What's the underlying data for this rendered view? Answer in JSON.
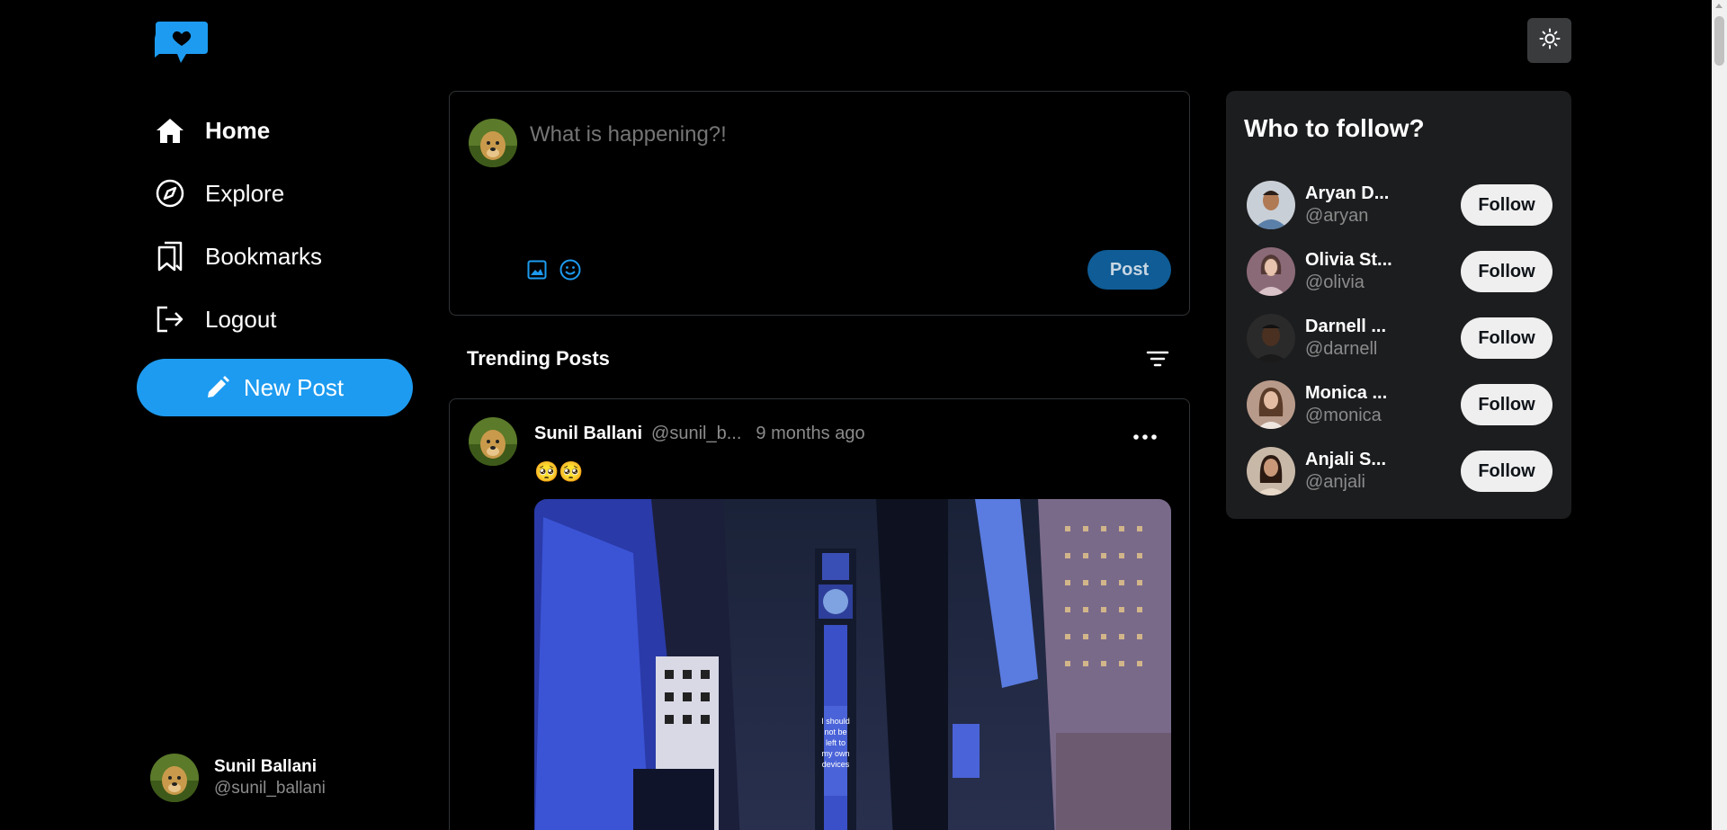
{
  "logo": {
    "icon": "chat-heart-logo-icon",
    "color": "#1d9bf0"
  },
  "nav": {
    "items": [
      {
        "label": "Home",
        "icon": "home-icon",
        "active": true
      },
      {
        "label": "Explore",
        "icon": "compass-icon"
      },
      {
        "label": "Bookmarks",
        "icon": "bookmarks-icon"
      },
      {
        "label": "Logout",
        "icon": "logout-icon"
      }
    ],
    "new_post_label": "New Post"
  },
  "current_user": {
    "name": "Sunil Ballani",
    "handle": "@sunil_ballani"
  },
  "compose": {
    "placeholder": "What is happening?!",
    "post_label": "Post",
    "tools": [
      "image-icon",
      "emoji-icon"
    ]
  },
  "feed": {
    "title": "Trending Posts",
    "filter_icon": "filter-icon",
    "posts": [
      {
        "author": "Sunil Ballani",
        "handle": "@sunil_b...",
        "time": "9 months ago",
        "text": "🥺🥺",
        "has_image": true
      }
    ]
  },
  "theme_toggle": {
    "icon": "sun-icon"
  },
  "who_to_follow": {
    "title": "Who to follow?",
    "button_label": "Follow",
    "users": [
      {
        "name": "Aryan D...",
        "handle": "@aryan"
      },
      {
        "name": "Olivia St...",
        "handle": "@olivia"
      },
      {
        "name": "Darnell ...",
        "handle": "@darnell"
      },
      {
        "name": "Monica ...",
        "handle": "@monica"
      },
      {
        "name": "Anjali S...",
        "handle": "@anjali"
      }
    ]
  },
  "colors": {
    "accent": "#1d9bf0",
    "background": "#000000",
    "panel": "#1c1d1f",
    "muted": "#8b8b8b"
  }
}
